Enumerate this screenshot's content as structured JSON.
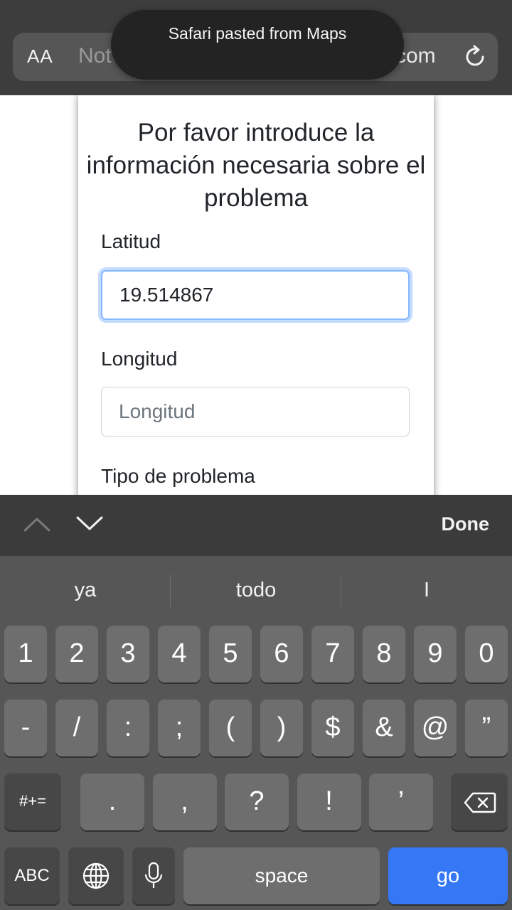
{
  "browser": {
    "reader_button": "AA",
    "url_left": "Not",
    "url_right": "com",
    "reload_icon": "reload-icon"
  },
  "toast": {
    "text": "Safari pasted from Maps"
  },
  "form": {
    "title": "Por favor introduce la información necesaria sobre el problema",
    "latitude": {
      "label": "Latitud",
      "value": "19.514867"
    },
    "longitude": {
      "label": "Longitud",
      "placeholder": "Longitud",
      "value": ""
    },
    "problem_type": {
      "label": "Tipo de problema"
    }
  },
  "accessory": {
    "prev_icon": "chevron-up-icon",
    "next_icon": "chevron-down-icon",
    "done_label": "Done"
  },
  "keyboard": {
    "suggestions": [
      "ya",
      "todo",
      "I"
    ],
    "row1": [
      "1",
      "2",
      "3",
      "4",
      "5",
      "6",
      "7",
      "8",
      "9",
      "0"
    ],
    "row2": [
      "-",
      "/",
      ":",
      ";",
      "(",
      ")",
      "$",
      "&",
      "@",
      "”"
    ],
    "row3_left": "#+=",
    "row3": [
      ".",
      ",",
      "?",
      "!",
      "’"
    ],
    "backspace_icon": "backspace-icon",
    "abc_label": "ABC",
    "globe_icon": "globe-icon",
    "mic_icon": "microphone-icon",
    "space_label": "space",
    "go_label": "go",
    "colors": {
      "go": "#3478f6",
      "focus": "#86b7fe"
    }
  }
}
